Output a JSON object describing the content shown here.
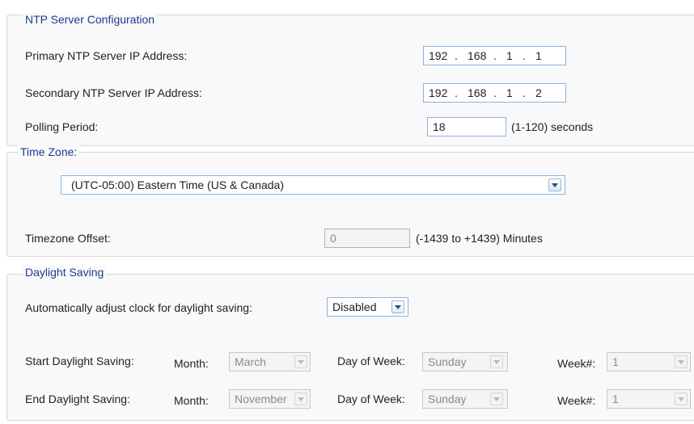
{
  "ntp": {
    "legend": "NTP Server Configuration",
    "primary_label": "Primary NTP Server IP Address:",
    "primary_ip": [
      "192",
      "168",
      "1",
      "1"
    ],
    "secondary_label": "Secondary NTP Server IP Address:",
    "secondary_ip": [
      "192",
      "168",
      "1",
      "2"
    ],
    "ip_separator": ".",
    "polling_label": "Polling Period:",
    "polling_value": "18",
    "polling_hint": "(1-120) seconds"
  },
  "timezone": {
    "legend": "Time Zone:",
    "selected": "(UTC-05:00) Eastern Time (US & Canada)",
    "offset_label": "Timezone Offset:",
    "offset_value": "0",
    "offset_hint": "(-1439 to +1439) Minutes"
  },
  "dst": {
    "legend": "Daylight Saving",
    "auto_label": "Automatically adjust clock for daylight saving:",
    "auto_value": "Disabled",
    "month_label": "Month:",
    "dow_label": "Day of Week:",
    "week_label": "Week#:",
    "start": {
      "label": "Start Daylight Saving:",
      "month": "March",
      "dow": "Sunday",
      "week": "1"
    },
    "end": {
      "label": "End Daylight Saving:",
      "month": "November",
      "dow": "Sunday",
      "week": "1"
    }
  },
  "colors": {
    "legend": "#1f3a93",
    "field_border": "#8cb4de",
    "panel_bg": "#f9f9f9"
  },
  "icons": {
    "dropdown": "chevron-down-icon"
  }
}
